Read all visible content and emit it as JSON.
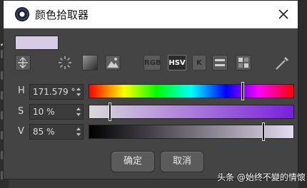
{
  "window": {
    "title": "颜色拾取器",
    "close_icon": "close-icon"
  },
  "preview": {
    "current_color": "#d6cce6"
  },
  "toolbar": {
    "rgb_label": "RGB",
    "hsv_label": "HSV",
    "k_label": "K",
    "icons": [
      "fit-icon",
      "color-wheel-icon",
      "gradient-square-icon",
      "image-icon",
      "sliders-icon",
      "swatches-icon",
      "eyedropper-icon"
    ]
  },
  "channels": {
    "h": {
      "label": "H",
      "value": "171.579 °"
    },
    "s": {
      "label": "S",
      "value": "10 %"
    },
    "v": {
      "label": "V",
      "value": "85 %"
    }
  },
  "buttons": {
    "ok": "确定",
    "cancel": "取消"
  },
  "watermark": "头条 @始终不變的情懷"
}
